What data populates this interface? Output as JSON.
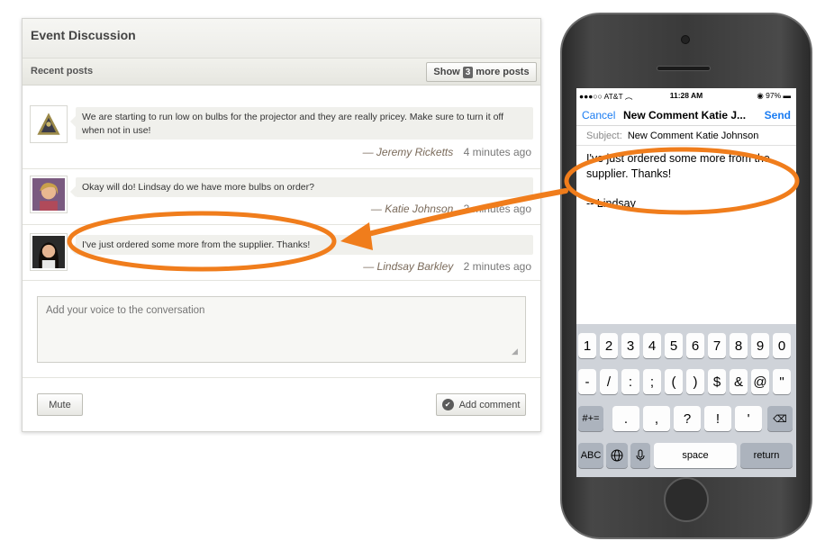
{
  "discussion": {
    "title": "Event Discussion",
    "recent_label": "Recent posts",
    "show_more": {
      "prefix": "Show",
      "count": "3",
      "suffix": "more posts"
    },
    "posts": [
      {
        "text": "We are starting to run low on bulbs for the projector and they are really pricey. Make sure to turn it off when not in use!",
        "author": "— Jeremy Ricketts",
        "time": "4 minutes ago"
      },
      {
        "text": "Okay will do! Lindsay do we have more bulbs on order?",
        "author": "— Katie Johnson",
        "time": "3 minutes ago"
      },
      {
        "text": "I've just ordered some more from the supplier. Thanks!",
        "author": "— Lindsay Barkley",
        "time": "2 minutes ago"
      }
    ],
    "comment_placeholder": "Add your voice to the conversation",
    "mute_label": "Mute",
    "add_comment_label": "Add comment"
  },
  "phone": {
    "status": {
      "carrier": "●●●○○ AT&T",
      "time": "11:28 AM",
      "battery": "97%"
    },
    "nav": {
      "cancel": "Cancel",
      "title": "New Comment Katie J...",
      "send": "Send"
    },
    "subject_label": "Subject:",
    "subject_value": "New Comment Katie Johnson",
    "body": "I've just ordered some more from the supplier. Thanks!",
    "signature": "-- Lindsay",
    "keyboard": {
      "row1": [
        "1",
        "2",
        "3",
        "4",
        "5",
        "6",
        "7",
        "8",
        "9",
        "0"
      ],
      "row2": [
        "-",
        "/",
        ":",
        ";",
        "(",
        ")",
        "$",
        "&",
        "@",
        "\""
      ],
      "row3_left": "#+=",
      "row3": [
        ".",
        ",",
        "?",
        "!",
        "'"
      ],
      "row4": {
        "abc": "ABC",
        "space": "space",
        "return": "return"
      }
    }
  },
  "colors": {
    "annotation": "#f07d1c",
    "ios_blue": "#1a7cf2"
  },
  "icons": [
    "check-icon",
    "resize-grip-icon",
    "wifi-icon",
    "globe-icon",
    "mic-icon",
    "backspace-icon"
  ]
}
